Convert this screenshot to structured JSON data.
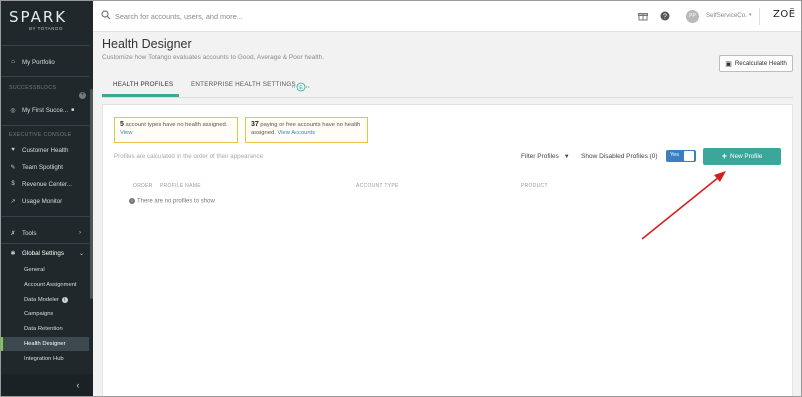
{
  "sidebar": {
    "logo_name": "SPARK",
    "logo_sub": "BY TOTANGO",
    "portfolio": "My Portfolio",
    "successblocs_label": "SUCCESSBLOCS",
    "first_success": "My First Succe...",
    "executive_label": "EXECUTIVE CONSOLE",
    "exec_items": [
      "Customer Health",
      "Team Spotlight",
      "Revenue Center...",
      "Usage Monitor"
    ],
    "tools": "Tools",
    "global_settings": "Global Settings",
    "settings_items": [
      "General",
      "Account Assignment",
      "Data Modeler",
      "Campaigns",
      "Data Retention",
      "Health Designer",
      "Integration Hub"
    ],
    "active_item": "Health Designer"
  },
  "topbar": {
    "search_placeholder": "Search for accounts, users, and more...",
    "avatar_initials": "PP",
    "company": "SelfServiceCo.",
    "brand": "ZOË"
  },
  "page": {
    "title": "Health Designer",
    "subtitle": "Customize how Totango evaluates accounts to Good, Average & Poor health.",
    "recalc_label": "Recalculate Health"
  },
  "tabs": [
    {
      "label": "HEALTH PROFILES",
      "active": true
    },
    {
      "label": "ENTERPRISE HEALTH SETTINGS",
      "active": false
    }
  ],
  "notices": [
    {
      "count": "5",
      "text": "account types have no health assigned.",
      "link": "View"
    },
    {
      "count": "37",
      "text": "paying or free accounts have no health assigned.",
      "link": "View Accounts"
    }
  ],
  "profiles": {
    "order_note": "Profiles are calculated in the order of their appearance",
    "filter_label": "Filter Profiles",
    "show_disabled_label": "Show Disabled Profiles (0)",
    "toggle_label": "Yes",
    "new_button": "New Profile",
    "columns": [
      "ORDER",
      "PROFILE NAME",
      "ACCOUNT TYPE",
      "PRODUCT"
    ],
    "empty_message": "There are no profiles to show"
  },
  "colors": {
    "accent": "#3aa79a",
    "sidebar_bg": "#20282b",
    "notice_border": "#e8c44a",
    "annotation_arrow": "#d62020"
  }
}
